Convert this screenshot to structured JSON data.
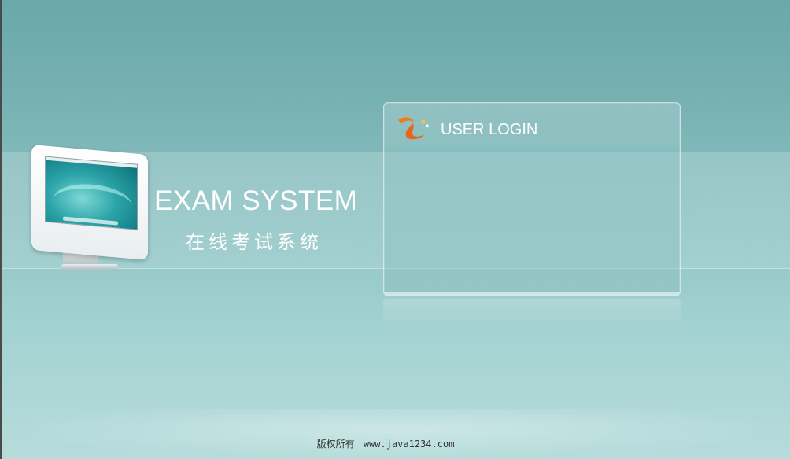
{
  "brand": {
    "title": "EXAM SYSTEM",
    "subtitle": "在线考试系统"
  },
  "login": {
    "title": "USER LOGIN",
    "logo_icon": "swirl-logo-icon"
  },
  "footer": {
    "copyright": "版权所有",
    "site": "www.java1234.com"
  },
  "colors": {
    "background_top": "#6aa8aa",
    "background_bottom": "#b6dcdb",
    "logo_orange": "#f07a1a",
    "text": "#ffffff"
  }
}
